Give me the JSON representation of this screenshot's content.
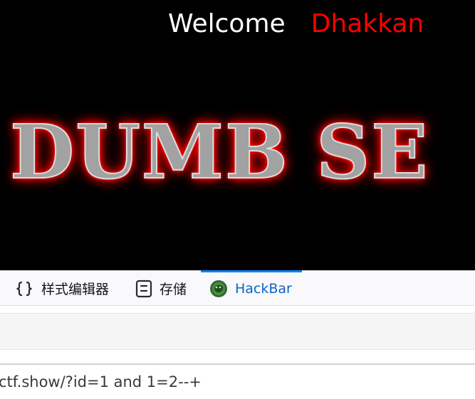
{
  "page": {
    "welcome_text": "Welcome",
    "username": "Dhakkan",
    "banner_text": "DUMB SE"
  },
  "devtools": {
    "tabs": [
      {
        "label": "样式编辑器",
        "icon": "braces-icon"
      },
      {
        "label": "存储",
        "icon": "storage-icon"
      },
      {
        "label": "HackBar",
        "icon": "hackbar-icon",
        "active": true
      }
    ],
    "url_value": "ctf.show/?id=1 and 1=2--+"
  },
  "colors": {
    "page_background": "#000000",
    "username_color": "#ff0000",
    "active_tab": "#0a84ff"
  }
}
